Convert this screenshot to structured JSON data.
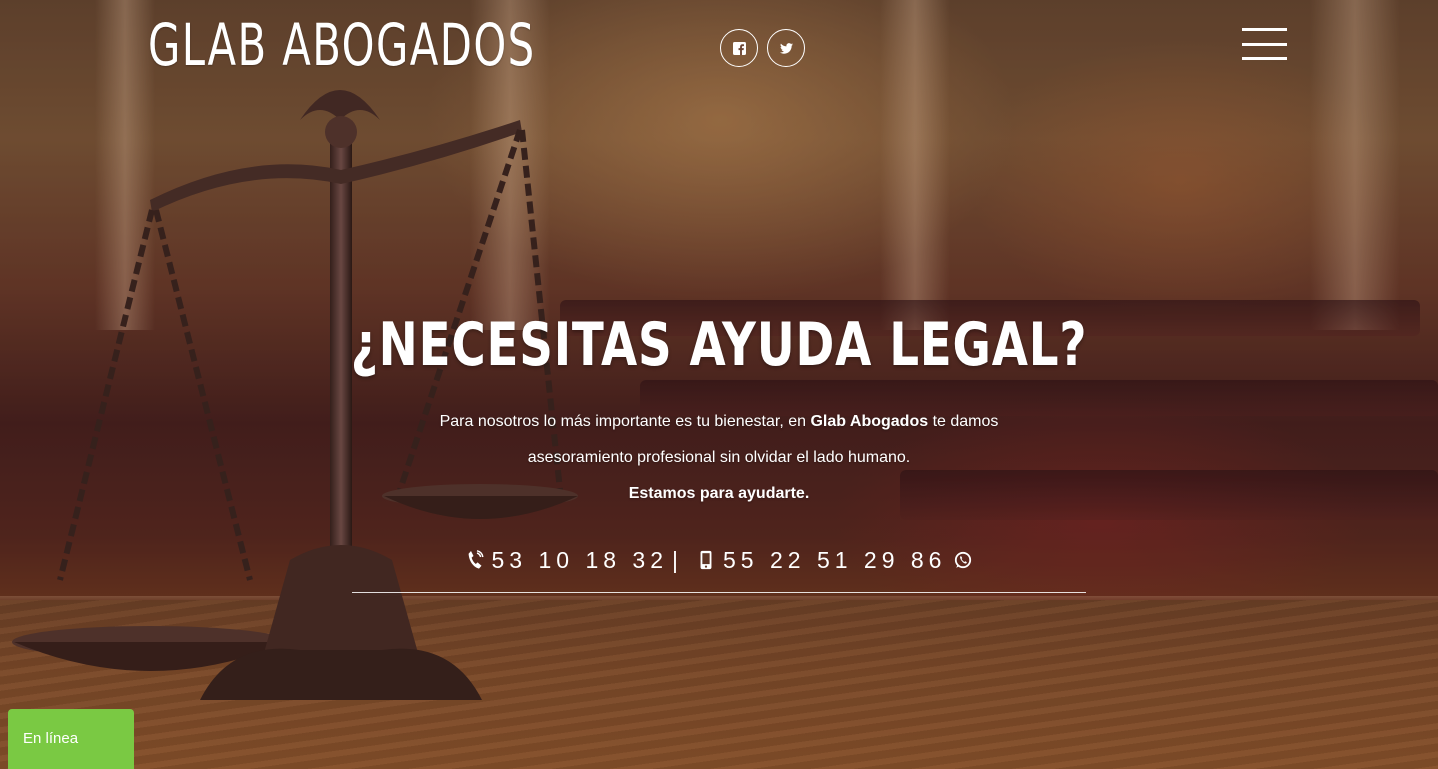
{
  "header": {
    "logo_text": "GLAB ABOGADOS",
    "social": [
      {
        "name": "facebook-icon"
      },
      {
        "name": "twitter-icon"
      }
    ],
    "menu_icon": "hamburger-menu-icon"
  },
  "hero": {
    "title": "¿NECESITAS AYUDA LEGAL?",
    "intro_before": "Para nosotros lo más importante es tu bienestar, en ",
    "intro_brand": "Glab Abogados",
    "intro_after": " te damos asesoramiento profesional sin olvidar el lado humano.",
    "tagline": "Estamos para ayudarte.",
    "phone_landline": "53 10 18 32",
    "separator": "|",
    "phone_mobile": "55 22 51 29 86",
    "icons": {
      "landline": "phone-icon",
      "mobile": "mobile-phone-icon",
      "whatsapp": "whatsapp-icon"
    }
  },
  "chat": {
    "status_label": "En línea",
    "color": "#7ac943"
  },
  "colors": {
    "text": "#ffffff"
  }
}
